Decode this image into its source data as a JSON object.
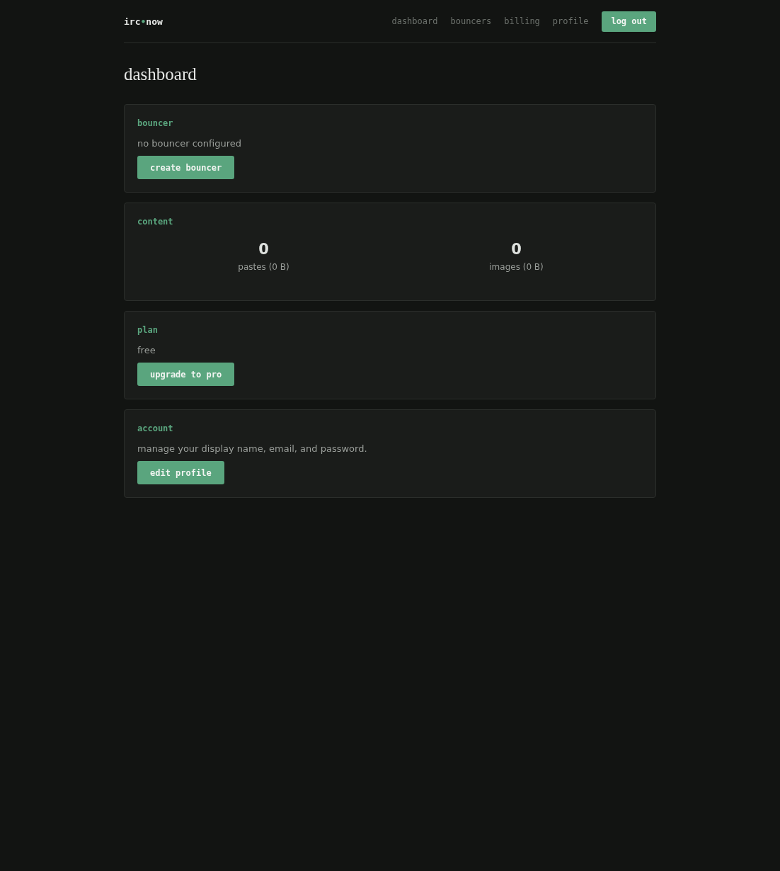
{
  "logo": {
    "start": "irc",
    "mark": "•",
    "end": "now"
  },
  "nav": [
    {
      "label": "dashboard"
    },
    {
      "label": "bouncers"
    },
    {
      "label": "billing"
    },
    {
      "label": "profile"
    }
  ],
  "logout": "log out",
  "title": "dashboard",
  "cards": [
    {
      "kind": "action",
      "heading": "bouncer",
      "text": "no bouncer configured",
      "button": "create bouncer"
    },
    {
      "kind": "stats",
      "heading": "content",
      "stats": [
        {
          "value": "0",
          "label": "pastes (0 B)"
        },
        {
          "value": "0",
          "label": "images (0 B)"
        }
      ]
    },
    {
      "kind": "action",
      "heading": "plan",
      "text": "free",
      "button": "upgrade to pro"
    },
    {
      "kind": "action",
      "heading": "account",
      "text": "manage your display name, email, and password.",
      "button": "edit profile"
    }
  ]
}
